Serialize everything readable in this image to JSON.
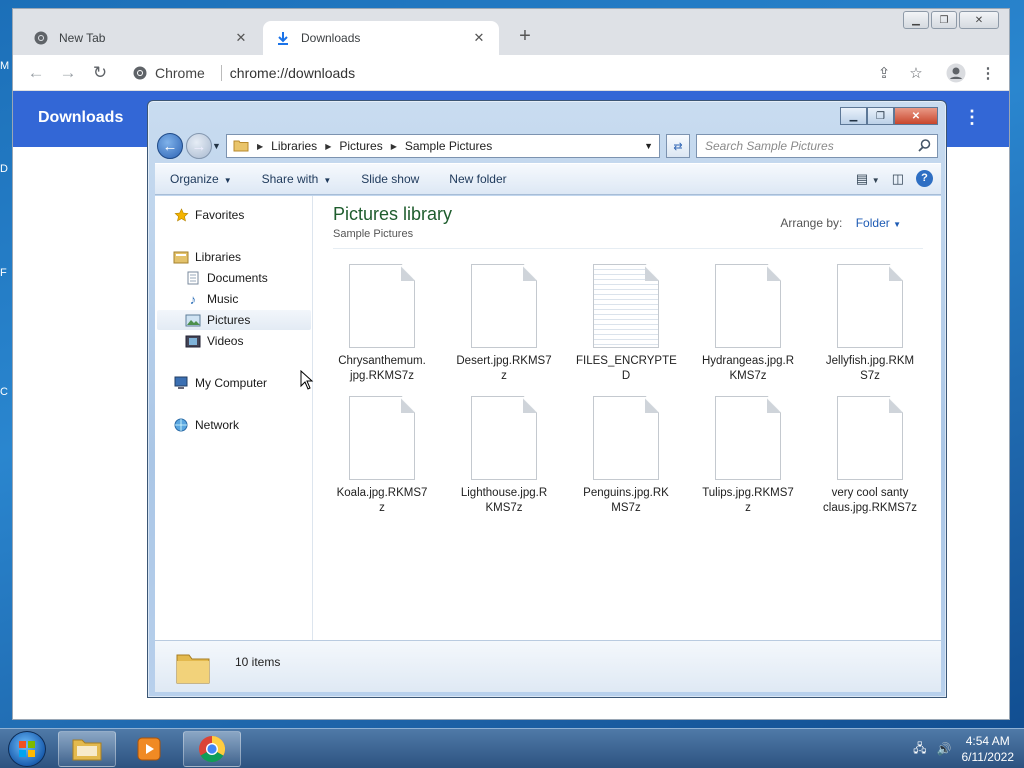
{
  "browser": {
    "tabs": [
      {
        "label": "New Tab",
        "active": false,
        "icon": "chrome-icon"
      },
      {
        "label": "Downloads",
        "active": true,
        "icon": "download-icon"
      }
    ],
    "new_tab_symbol": "+",
    "site_label": "Chrome",
    "url": "chrome://downloads",
    "page_title": "Downloads"
  },
  "explorer": {
    "breadcrumb": [
      "Libraries",
      "Pictures",
      "Sample Pictures"
    ],
    "search_placeholder": "Search Sample Pictures",
    "commands": [
      {
        "label": "Organize",
        "dropdown": true
      },
      {
        "label": "Share with",
        "dropdown": true
      },
      {
        "label": "Slide show",
        "dropdown": false
      },
      {
        "label": "New folder",
        "dropdown": false
      }
    ],
    "nav": {
      "favorites": "Favorites",
      "libraries": "Libraries",
      "library_items": [
        "Documents",
        "Music",
        "Pictures",
        "Videos"
      ],
      "selected": "Pictures",
      "my_computer": "My Computer",
      "network": "Network"
    },
    "library_title": "Pictures library",
    "library_subtitle": "Sample Pictures",
    "arrange_label": "Arrange by:",
    "arrange_value": "Folder",
    "files": [
      {
        "name_lines": [
          "Chrysanthemum.",
          "jpg.RKMS7z"
        ]
      },
      {
        "name_lines": [
          "Desert.jpg.RKMS7",
          "z"
        ]
      },
      {
        "name_lines": [
          "FILES_ENCRYPTE",
          "D"
        ],
        "lined": true
      },
      {
        "name_lines": [
          "Hydrangeas.jpg.R",
          "KMS7z"
        ]
      },
      {
        "name_lines": [
          "Jellyfish.jpg.RKM",
          "S7z"
        ]
      },
      {
        "name_lines": [
          "Koala.jpg.RKMS7",
          "z"
        ]
      },
      {
        "name_lines": [
          "Lighthouse.jpg.R",
          "KMS7z"
        ]
      },
      {
        "name_lines": [
          "Penguins.jpg.RK",
          "MS7z"
        ]
      },
      {
        "name_lines": [
          "Tulips.jpg.RKMS7",
          "z"
        ]
      },
      {
        "name_lines": [
          "very cool santy",
          "claus.jpg.RKMS7z"
        ]
      }
    ],
    "item_count": "10 items"
  },
  "taskbar": {
    "time": "4:54 AM",
    "date": "6/11/2022"
  },
  "desktop_edge_letters": [
    "M",
    "D",
    "F",
    "C"
  ]
}
